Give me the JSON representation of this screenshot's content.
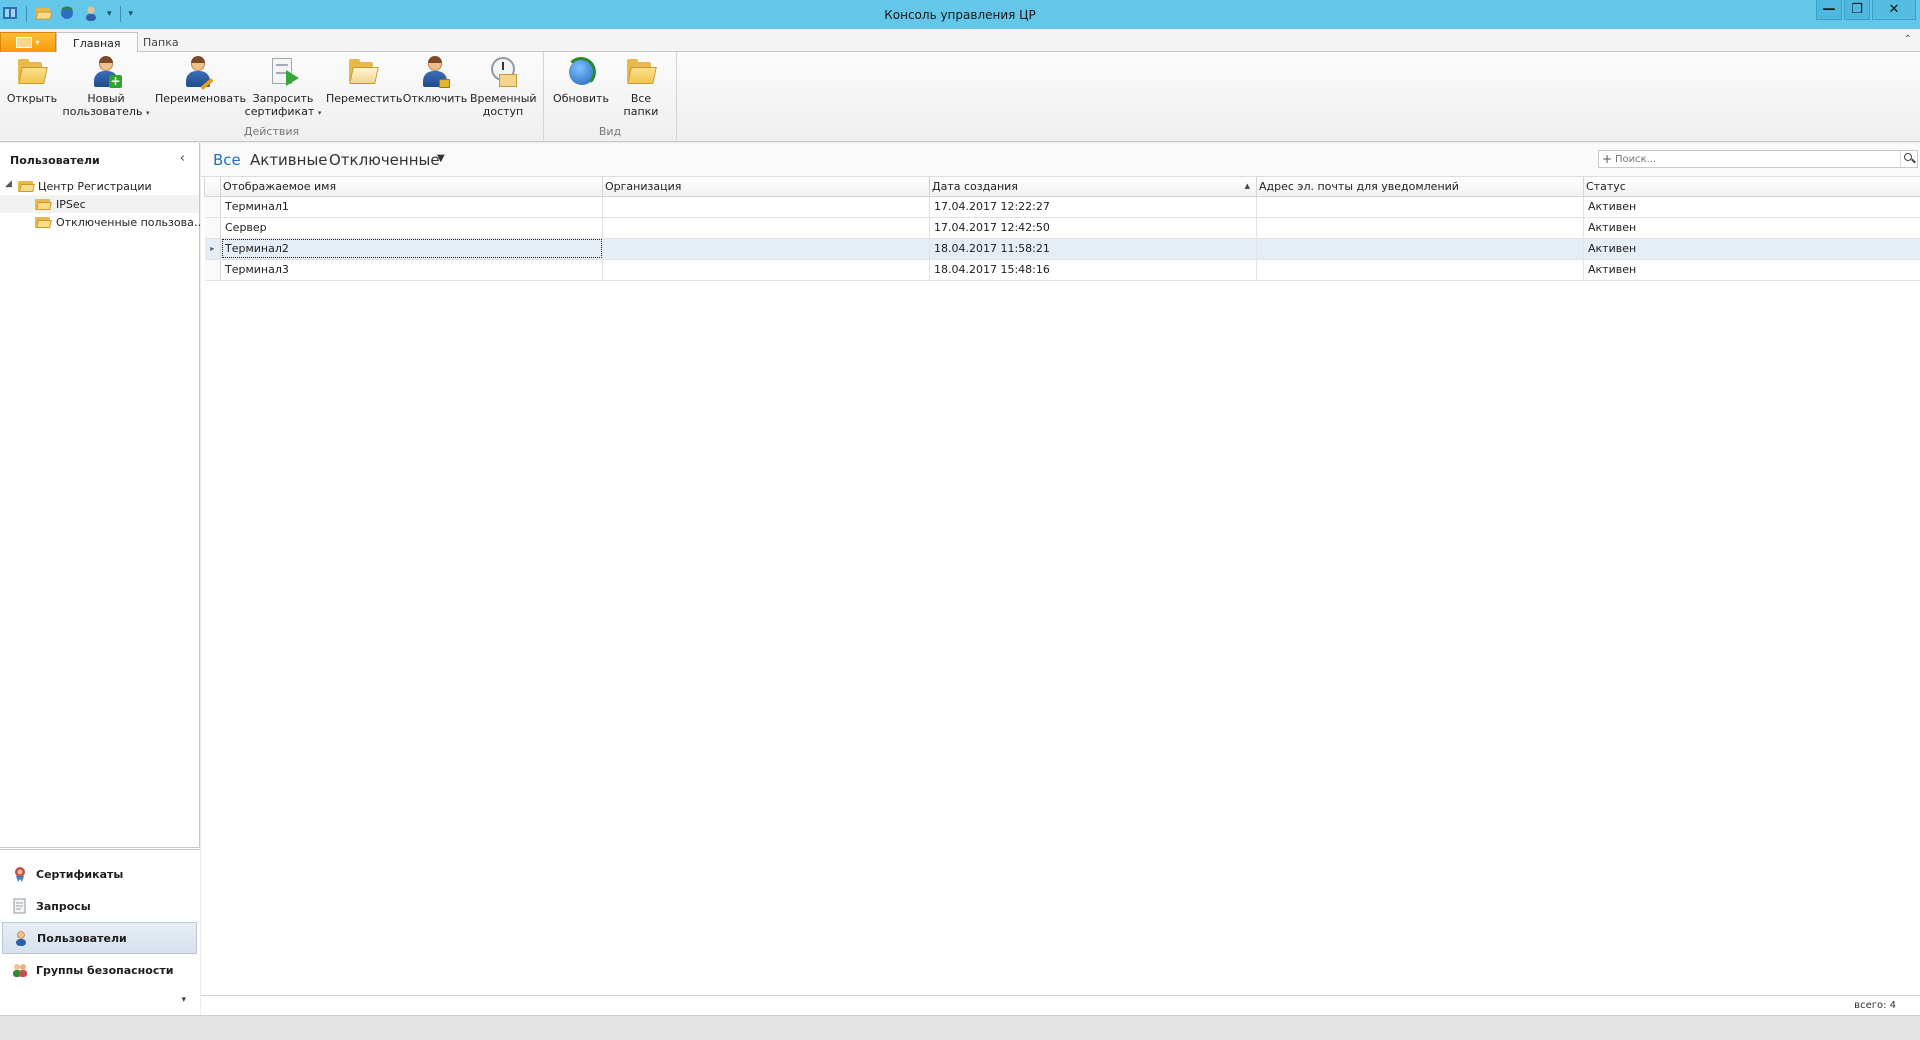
{
  "window": {
    "title": "Консоль управления ЦР",
    "minimize": "—",
    "restore": "❐",
    "close": "✕"
  },
  "quick_access": {
    "icons": [
      "app-icon",
      "open-folder-icon",
      "refresh-icon",
      "user-icon"
    ],
    "customize": "▾"
  },
  "ribbon": {
    "tabs": [
      "Главная",
      "Папка"
    ],
    "active_tab": "Главная",
    "groups": {
      "actions": {
        "label": "Действия",
        "buttons": {
          "open": "Открыть",
          "new_user_1": "Новый",
          "new_user_2": "пользователь",
          "rename": "Переименовать",
          "request_cert_1": "Запросить",
          "request_cert_2": "сертификат",
          "move": "Переместить",
          "disable": "Отключить",
          "temp_access_1": "Временный",
          "temp_access_2": "доступ"
        }
      },
      "view": {
        "label": "Вид",
        "buttons": {
          "refresh": "Обновить",
          "all_folders": "Все папки"
        }
      }
    }
  },
  "left_pane": {
    "title": "Пользователи",
    "tree": [
      {
        "label": "Центр Регистрации",
        "level": 0,
        "expanded": true
      },
      {
        "label": "IPSec",
        "level": 1,
        "selected": true
      },
      {
        "label": "Отключенные пользова…",
        "level": 1
      }
    ],
    "nav": [
      {
        "label": "Сертификаты",
        "icon": "certificate-icon",
        "active": false
      },
      {
        "label": "Запросы",
        "icon": "request-icon",
        "active": false
      },
      {
        "label": "Пользователи",
        "icon": "users-icon",
        "active": true
      },
      {
        "label": "Группы безопасности",
        "icon": "security-groups-icon",
        "active": false
      }
    ]
  },
  "main": {
    "filters": [
      "Все",
      "Активные",
      "Отключенные"
    ],
    "active_filter": "Все",
    "search_placeholder": "Поиск...",
    "columns": [
      "Отображаемое имя",
      "Организация",
      "Дата создания",
      "Адрес эл. почты для уведомлений",
      "Статус"
    ],
    "sorted_column": "Дата создания",
    "rows": [
      {
        "name": "Терминал1",
        "org": "",
        "created": "17.04.2017 12:22:27",
        "email": "",
        "status": "Активен"
      },
      {
        "name": "Сервер",
        "org": "",
        "created": "17.04.2017 12:42:50",
        "email": "",
        "status": "Активен"
      },
      {
        "name": "Терминал2",
        "org": "",
        "created": "18.04.2017 11:58:21",
        "email": "",
        "status": "Активен",
        "selected": true
      },
      {
        "name": "Терминал3",
        "org": "",
        "created": "18.04.2017 15:48:16",
        "email": "",
        "status": "Активен"
      }
    ],
    "total": "всего: 4"
  },
  "colors": {
    "titlebar": "#64c6e8",
    "app_button": "#f59b07",
    "active_filter": "#1f73c2",
    "selected_row": "#e5edf6"
  }
}
